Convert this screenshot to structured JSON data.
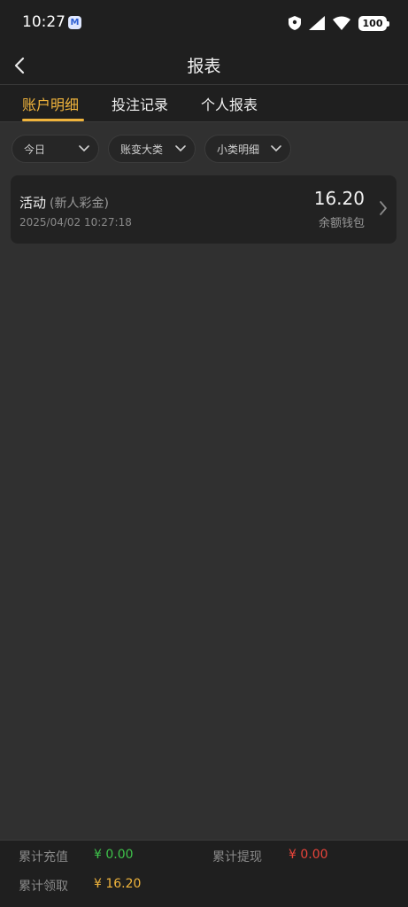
{
  "status_bar": {
    "time": "10:27",
    "app_icon": "M",
    "icons": [
      "shield-icon",
      "signal-icon",
      "wifi-icon",
      "battery-icon"
    ],
    "battery": "100"
  },
  "header": {
    "title": "报表",
    "back_icon": "chevron-left-icon"
  },
  "tabs": [
    {
      "label": "账户明细",
      "active": true
    },
    {
      "label": "投注记录",
      "active": false
    },
    {
      "label": "个人报表",
      "active": false
    }
  ],
  "filters": [
    {
      "label": "今日"
    },
    {
      "label": "账变大类"
    },
    {
      "label": "小类明细"
    }
  ],
  "records": [
    {
      "title": "活动",
      "subtitle": "(新人彩金)",
      "time": "2025/04/02 10:27:18",
      "amount": "16.20",
      "wallet": "余额钱包"
    }
  ],
  "summary": {
    "total_deposit_label": "累计充值",
    "total_deposit_value": "¥ 0.00",
    "total_withdraw_label": "累计提现",
    "total_withdraw_value": "¥ 0.00",
    "total_claim_label": "累计领取",
    "total_claim_value": "¥ 16.20"
  },
  "colors": {
    "accent": "#f0b43c",
    "deposit": "#3ec24a",
    "withdraw": "#e8443a",
    "claim": "#f0b43c"
  }
}
